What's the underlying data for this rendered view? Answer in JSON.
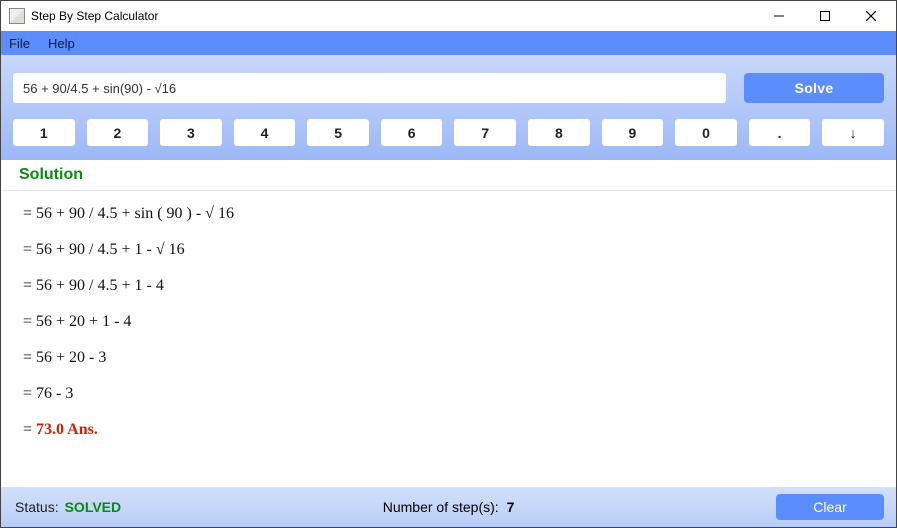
{
  "window": {
    "title": "Step By Step Calculator"
  },
  "menu": {
    "file": "File",
    "help": "Help"
  },
  "input": {
    "expression": "56 + 90/4.5 + sin(90) - √16",
    "solve_label": "Solve"
  },
  "keypad": [
    "1",
    "2",
    "3",
    "4",
    "5",
    "6",
    "7",
    "8",
    "9",
    "0",
    ".",
    "↓"
  ],
  "solution": {
    "header": "Solution",
    "steps": [
      "= 56 + 90 / 4.5 + sin ( 90 ) - √ 16",
      "= 56 + 90 / 4.5 + 1 - √ 16",
      "= 56 + 90 / 4.5 + 1 - 4",
      "= 56 + 20 + 1 - 4",
      "= 56 + 20 - 3",
      "= 76 - 3"
    ],
    "answer_prefix": "= ",
    "answer": "73.0 Ans."
  },
  "status": {
    "label": "Status:",
    "value": "SOLVED",
    "steps_label": "Number of step(s):",
    "steps_count": "7",
    "clear_label": "Clear"
  }
}
